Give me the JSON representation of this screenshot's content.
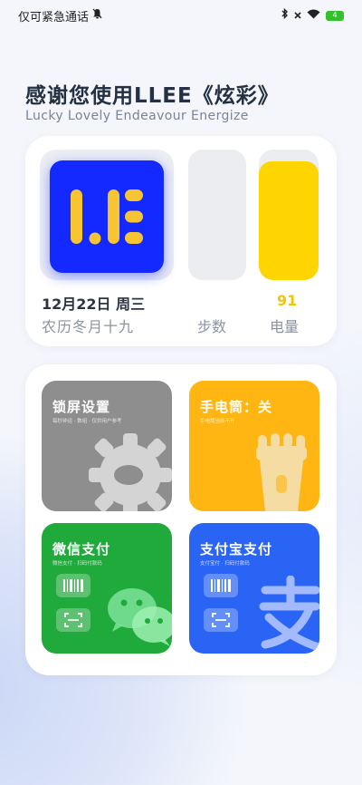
{
  "status_bar": {
    "carrier": "仅可紧急通话",
    "icons": [
      "mute-bell-icon",
      "bluetooth-icon",
      "no-signal-icon",
      "wifi-icon",
      "battery-icon"
    ],
    "battery_text": "4"
  },
  "header": {
    "title": "感谢您使用LLEE《炫彩》",
    "subtitle": "Lucky Lovely Endeavour Energize"
  },
  "info_card": {
    "date": "12月22日 周三",
    "lunar": "农历冬月十九",
    "steps_label": "步数",
    "battery_value": "91",
    "battery_label": "电量",
    "battery_level_percent": 91,
    "colors": {
      "logo_bg": "#1329ff",
      "logo_letters": "#f7c531",
      "battery_fill": "#ffd500"
    }
  },
  "tiles": {
    "lock": {
      "title": "锁屏设置",
      "subtitle": "每秒钟运 · 数组 · 仅供用户参考",
      "color": "#8e8e8e"
    },
    "torch": {
      "title": "手电筒：关",
      "subtitle": "手电筒当前不开",
      "color": "#ffb612"
    },
    "wechat": {
      "title": "微信支付",
      "subtitle": "微信支付 · 扫码付款码",
      "color": "#1faa3b"
    },
    "alipay": {
      "title": "支付宝支付",
      "subtitle": "支付宝付 · 扫码付款码",
      "color": "#2a64f5"
    }
  }
}
